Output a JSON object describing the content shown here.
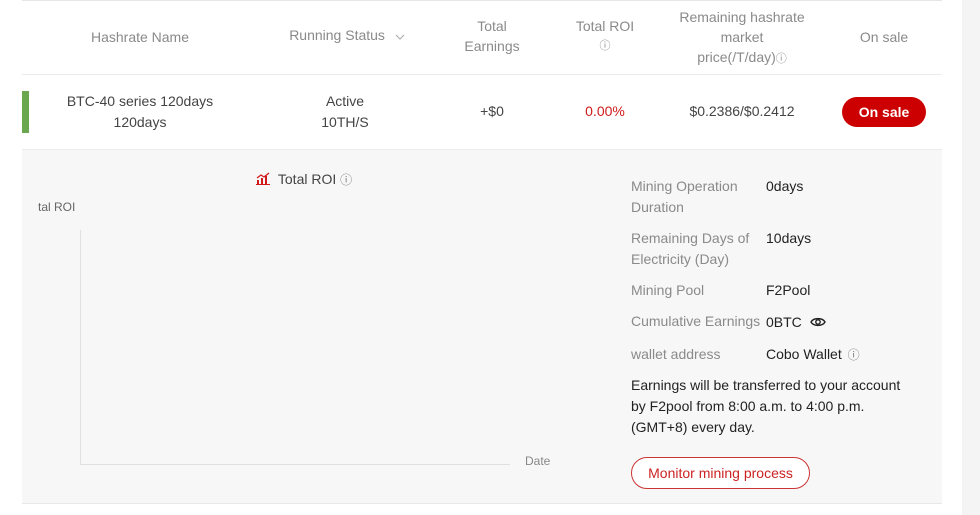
{
  "header": {
    "hashrate_name": "Hashrate Name",
    "running_status": "Running Status",
    "sort_icon": "chevron-down-icon",
    "total_earnings_line1": "Total",
    "total_earnings_line2": "Earnings",
    "total_roi": "Total ROI",
    "remaining_line1": "Remaining hashrate",
    "remaining_line2": "market",
    "remaining_line3": "price(/T/day)",
    "on_sale": "On sale",
    "info_glyph": "ⓘ"
  },
  "row": {
    "status_color": "#6aa84f",
    "name_line1": "BTC-40 series 120days",
    "name_line2": "120days",
    "status": "Active",
    "hashrate": "10TH/S",
    "earnings": "+$0",
    "roi": "0.00%",
    "price": "$0.2386/$0.2412",
    "button": "On sale"
  },
  "chart": {
    "title": "Total ROI",
    "title_icon": "chart-icon",
    "info_glyph": "ⓘ",
    "ylabel": "tal ROI",
    "xlabel": "Date"
  },
  "details": {
    "mining_duration_label_1": "Mining Operation",
    "mining_duration_label_2": "Duration",
    "mining_duration_value": "0days",
    "electricity_label_1": "Remaining Days of",
    "electricity_label_2": "Electricity (Day)",
    "electricity_value": "10days",
    "pool_label": "Mining Pool",
    "pool_value": "F2Pool",
    "cumulative_label": "Cumulative Earnings",
    "cumulative_value": "0BTC",
    "wallet_label": "wallet address",
    "wallet_value": "Cobo Wallet",
    "info_glyph": "ⓘ",
    "note_1": "Earnings will be transferred to your account",
    "note_2": "by F2pool from 8:00 a.m. to 4:00 p.m.",
    "note_3": "(GMT+8) every day.",
    "monitor_button": "Monitor mining process"
  },
  "colors": {
    "accent": "#cc0000",
    "roi_text": "#d11a1a",
    "panel_bg": "#f7f7f7"
  }
}
